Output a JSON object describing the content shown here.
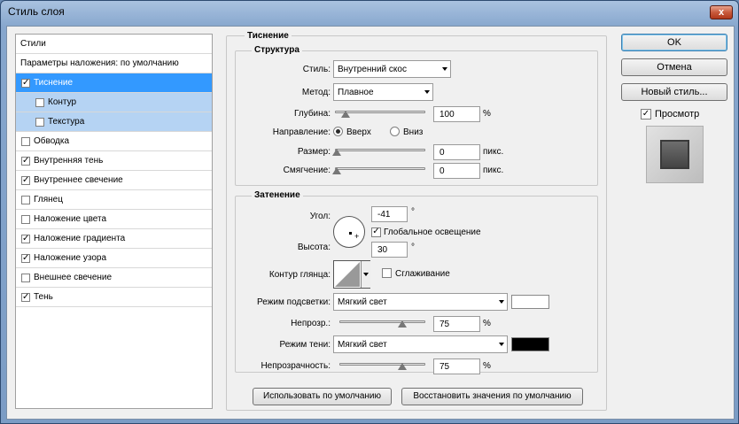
{
  "window": {
    "title": "Стиль слоя",
    "close": "x"
  },
  "styles_list": {
    "header": "Стили",
    "blending": "Параметры наложения: по умолчанию",
    "items": [
      {
        "label": "Тиснение",
        "checked": true,
        "selected": true
      },
      {
        "label": "Контур",
        "checked": false,
        "sub": true
      },
      {
        "label": "Текстура",
        "checked": false,
        "sub": true
      },
      {
        "label": "Обводка",
        "checked": false
      },
      {
        "label": "Внутренняя тень",
        "checked": true
      },
      {
        "label": "Внутреннее свечение",
        "checked": true
      },
      {
        "label": "Глянец",
        "checked": false
      },
      {
        "label": "Наложение цвета",
        "checked": false
      },
      {
        "label": "Наложение градиента",
        "checked": true
      },
      {
        "label": "Наложение узора",
        "checked": true
      },
      {
        "label": "Внешнее свечение",
        "checked": false
      },
      {
        "label": "Тень",
        "checked": true
      }
    ],
    "check_mark": "✓"
  },
  "emboss": {
    "title": "Тиснение",
    "structure": {
      "title": "Структура",
      "style_label": "Стиль:",
      "style_value": "Внутренний скос",
      "method_label": "Метод:",
      "method_value": "Плавное",
      "depth_label": "Глубина:",
      "depth_value": "100",
      "depth_unit": "%",
      "direction_label": "Направление:",
      "dir_up": "Вверх",
      "dir_down": "Вниз",
      "size_label": "Размер:",
      "size_value": "0",
      "size_unit": "пикс.",
      "soften_label": "Смягчение:",
      "soften_value": "0",
      "soften_unit": "пикс."
    },
    "shading": {
      "title": "Затенение",
      "angle_label": "Угол:",
      "angle_value": "-41",
      "angle_unit": "°",
      "global_light": "Глобальное освещение",
      "altitude_label": "Высота:",
      "altitude_value": "30",
      "altitude_unit": "°",
      "gloss_label": "Контур глянца:",
      "antialias": "Сглаживание",
      "highlight_label": "Режим подсветки:",
      "highlight_value": "Мягкий свет",
      "highlight_opacity_label": "Непрозр.:",
      "highlight_opacity": "75",
      "highlight_unit": "%",
      "shadow_label": "Режим тени:",
      "shadow_value": "Мягкий свет",
      "shadow_opacity_label": "Непрозрачность:",
      "shadow_opacity": "75",
      "shadow_unit": "%",
      "highlight_color": "#ffffff",
      "shadow_color": "#000000"
    },
    "make_default": "Использовать по умолчанию",
    "reset_default": "Восстановить значения по умолчанию"
  },
  "actions": {
    "ok": "OK",
    "cancel": "Отмена",
    "new_style": "Новый стиль...",
    "preview": "Просмотр"
  }
}
